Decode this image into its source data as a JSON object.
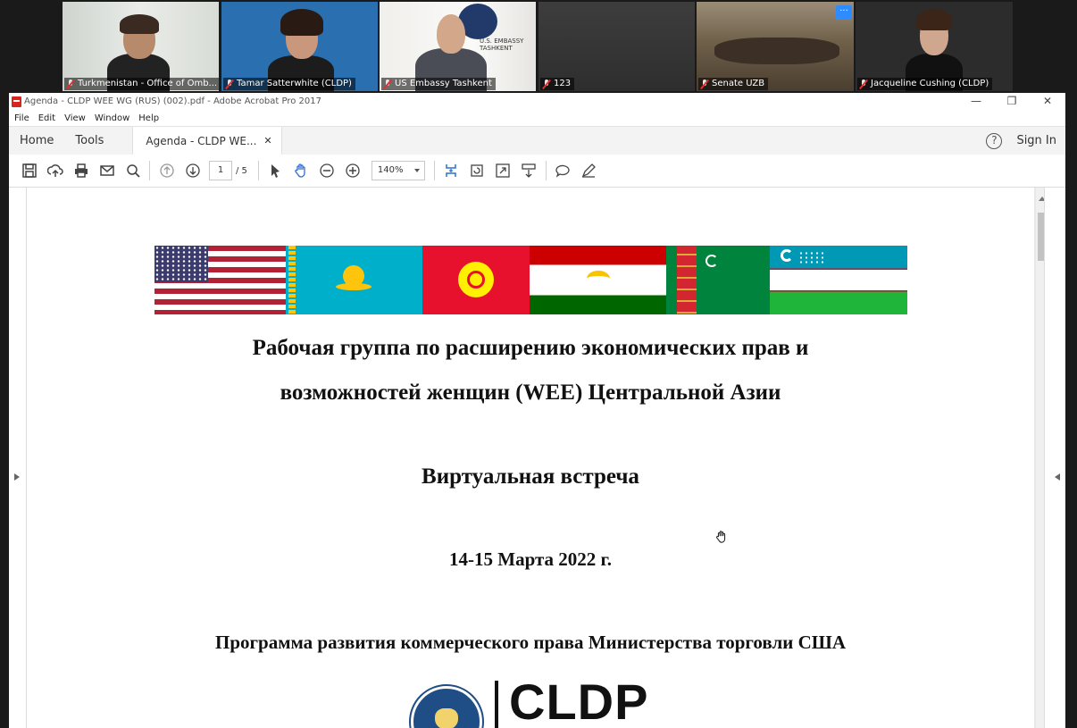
{
  "participants": [
    {
      "name": "Turkmenistan - Office of Omb..."
    },
    {
      "name": "Tamar Satterwhite (CLDP)"
    },
    {
      "name": "US Embassy Tashkent"
    },
    {
      "name": "123"
    },
    {
      "name": "Senate UZB"
    },
    {
      "name": "Jacqueline Cushing (CLDP)"
    }
  ],
  "participant_more": "···",
  "embassy_sign": "U.S. EMBASSY\nTASHKENT",
  "window": {
    "title": "Agenda - CLDP WEE WG (RUS) (002).pdf - Adobe Acrobat Pro 2017",
    "minimize": "—",
    "restore": "❐",
    "close": "✕"
  },
  "menu": [
    "File",
    "Edit",
    "View",
    "Window",
    "Help"
  ],
  "tabs": {
    "home": "Home",
    "tools": "Tools",
    "doc_tab": "Agenda - CLDP WE...",
    "doc_tab_close": "✕",
    "help": "?",
    "sign_in": "Sign In"
  },
  "toolbar": {
    "page_current": "1",
    "page_total": "/ 5",
    "zoom": "140%"
  },
  "document": {
    "title_line1": "Рабочая группа по расширению экономических прав и",
    "title_line2": "возможностей женщин (WEE) Центральной Азии",
    "subtitle": "Виртуальная встреча",
    "date": "14-15 Марта 2022 г.",
    "program": "Программа развития коммерческого права Министерства торговли США",
    "logo_text": "CLDP"
  },
  "colors": {
    "accent_active_speaker": "#2dbf4b",
    "pdf_red": "#d9261c",
    "zoom_blue": "#2d8cff"
  },
  "icons": [
    "save-icon",
    "upload-icon",
    "print-icon",
    "email-icon",
    "search-icon",
    "page-up-icon",
    "page-down-icon",
    "select-cursor-icon",
    "hand-tool-icon",
    "zoom-out-icon",
    "zoom-in-icon",
    "fit-page-icon",
    "rotate-icon",
    "fullscreen-icon",
    "scroll-mode-icon",
    "comment-icon",
    "pen-icon"
  ]
}
